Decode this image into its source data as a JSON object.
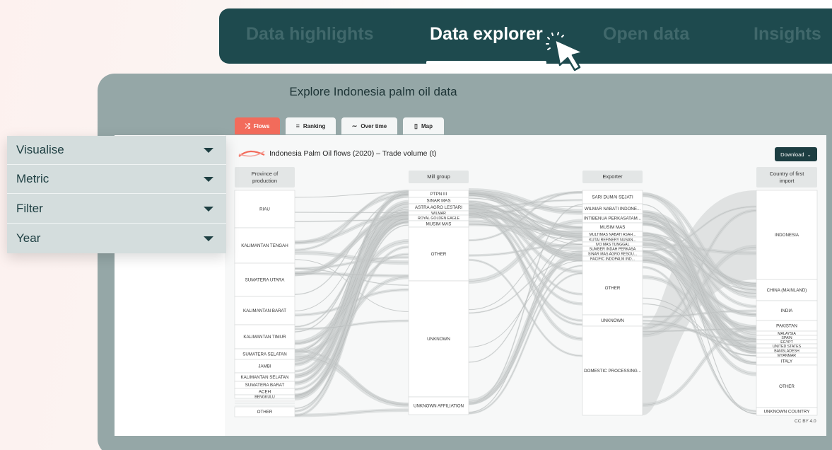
{
  "nav": {
    "items": [
      {
        "label": "Data highlights",
        "active": false
      },
      {
        "label": "Data explorer",
        "active": true
      },
      {
        "label": "Open data",
        "active": false
      },
      {
        "label": "Insights",
        "active": false
      }
    ]
  },
  "panel": {
    "title": "Explore Indonesia palm oil data"
  },
  "tabs": [
    {
      "label": "Flows",
      "icon": "flows-icon",
      "active": true
    },
    {
      "label": "Ranking",
      "icon": "ranking-icon",
      "active": false
    },
    {
      "label": "Over time",
      "icon": "trend-icon",
      "active": false
    },
    {
      "label": "Map",
      "icon": "map-icon",
      "active": false
    }
  ],
  "menu": {
    "items": [
      {
        "label": "Visualise"
      },
      {
        "label": "Metric"
      },
      {
        "label": "Filter"
      },
      {
        "label": "Year"
      }
    ]
  },
  "chart": {
    "title": "Indonesia Palm Oil flows (2020) – Trade volume (t)",
    "download_label": "Download",
    "license": "CC BY 4.0",
    "columns": [
      "Province of\nproduction",
      "Mill group",
      "Exporter",
      "Country of first\nimport"
    ]
  },
  "chart_data": {
    "type": "sankey",
    "columns": [
      {
        "name": "Province of production",
        "nodes": [
          "RIAU",
          "KALIMANTAN TENGAH",
          "SUMATERA UTARA",
          "KALIMANTAN BARAT",
          "KALIMANTAN TIMUR",
          "SUMATERA SELATAN",
          "JAMBI",
          "KALIMANTAN SELATAN",
          "SUMATERA BARAT",
          "ACEH",
          "BENGKULU",
          "OTHER"
        ]
      },
      {
        "name": "Mill group",
        "nodes": [
          "PTPN III",
          "SINAR MAS",
          "ASTRA AGRO LESTARI",
          "WILMAR",
          "ROYAL GOLDEN EAGLE",
          "MUSIM MAS",
          "OTHER",
          "UNKNOWN",
          "UNKNOWN AFFILIATION"
        ]
      },
      {
        "name": "Exporter",
        "nodes": [
          "SARI DUMAI SEJATI",
          "WILMAR NABATI INDONE...",
          "INTIBENUA PERKASATAM...",
          "MUSIM MAS",
          "MULTIMAS NABATI ASAH...",
          "KUTAI REFINERY NUSAN...",
          "IVO MAS TUNGGAL",
          "SUMBER INDAH PERKASA",
          "SINAR MAS AGRO RESOU...",
          "PACIFIC INDOPALM IND...",
          "OTHER",
          "UNKNOWN",
          "DOMESTIC PROCESSING..."
        ]
      },
      {
        "name": "Country of first import",
        "nodes": [
          "INDONESIA",
          "CHINA (MAINLAND)",
          "INDIA",
          "PAKISTAN",
          "MALAYSIA",
          "SPAIN",
          "EGYPT",
          "UNITED STATES",
          "BANGLADESH",
          "MYANMAR",
          "ITALY",
          "OTHER",
          "UNKNOWN COUNTRY"
        ]
      }
    ]
  },
  "colors": {
    "nav_bg": "#1e4a4e",
    "nav_inactive": "#40686b",
    "accent": "#f26b5b",
    "download_bg": "#1d3e42",
    "panel_bg": "#95a7a7",
    "menu_bg": "#d4dddd"
  }
}
